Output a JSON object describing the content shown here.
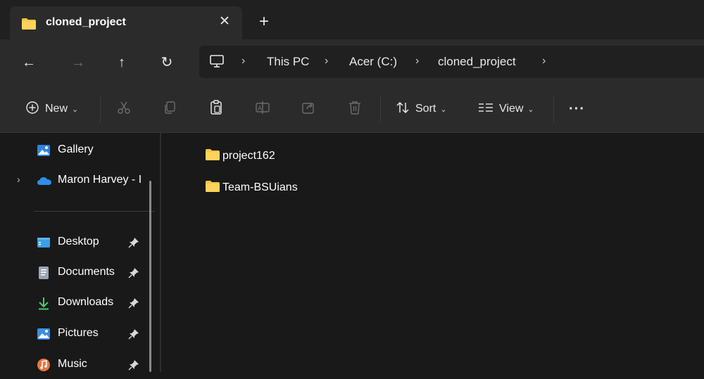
{
  "window": {
    "tab_title": "cloned_project",
    "tab_close_glyph": "✕",
    "new_tab_glyph": "+"
  },
  "nav": {
    "back_glyph": "←",
    "forward_glyph": "→",
    "up_glyph": "↑",
    "refresh_glyph": "↻",
    "breadcrumbs": [
      "This PC",
      "Acer (C:)",
      "cloned_project"
    ],
    "chevron_glyph": "›"
  },
  "toolbar": {
    "new_label": "New",
    "sort_label": "Sort",
    "view_label": "View",
    "more_glyph": "···",
    "caret_glyph": "⌄"
  },
  "sidebar": {
    "items": [
      {
        "label": "Gallery",
        "icon": "gallery-icon"
      },
      {
        "label": "Maron Harvey - I",
        "icon": "onedrive-cloud-icon"
      },
      {
        "label": "Desktop",
        "icon": "desktop-folder-icon",
        "pinned": true
      },
      {
        "label": "Documents",
        "icon": "documents-icon",
        "pinned": true
      },
      {
        "label": "Downloads",
        "icon": "download-arrow-icon",
        "pinned": true
      },
      {
        "label": "Pictures",
        "icon": "pictures-icon",
        "pinned": true
      },
      {
        "label": "Music",
        "icon": "music-icon",
        "pinned": true
      }
    ]
  },
  "content": {
    "items": [
      {
        "name": "project162",
        "type": "folder"
      },
      {
        "name": "Team-BSUians",
        "type": "folder"
      }
    ]
  },
  "colors": {
    "folder_yellow": "#f8c542",
    "background": "#191919",
    "toolbar_bg": "#2b2b2b"
  }
}
